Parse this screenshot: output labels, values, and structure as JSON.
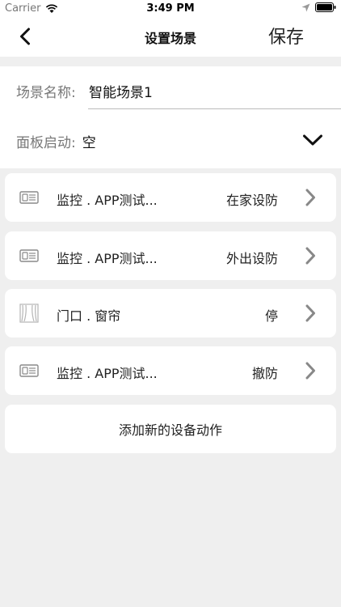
{
  "status": {
    "carrier": "Carrier",
    "time": "3:49 PM"
  },
  "nav": {
    "title": "设置场景",
    "save_label": "保存"
  },
  "form": {
    "name_label": "场景名称:",
    "name_value": "智能场景1",
    "panel_label": "面板启动:",
    "panel_value": "空"
  },
  "devices": [
    {
      "name": "监控 . APP测试...",
      "action": "在家设防",
      "icon": "panel-device-icon"
    },
    {
      "name": "监控 . APP测试...",
      "action": "外出设防",
      "icon": "panel-device-icon"
    },
    {
      "name": "门口 . 窗帘",
      "action": "停",
      "icon": "curtain-icon"
    },
    {
      "name": "监控 . APP测试...",
      "action": "撤防",
      "icon": "panel-device-icon"
    }
  ],
  "add_action_label": "添加新的设备动作"
}
